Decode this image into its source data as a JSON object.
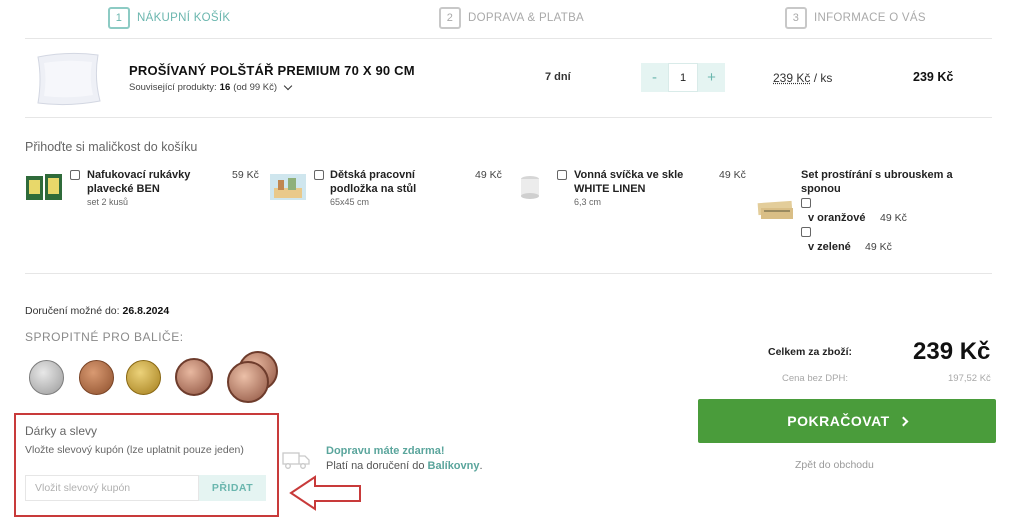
{
  "steps": [
    {
      "num": "1",
      "label": "NÁKUPNÍ KOŠÍK"
    },
    {
      "num": "2",
      "label": "DOPRAVA & PLATBA"
    },
    {
      "num": "3",
      "label": "INFORMACE O VÁS"
    }
  ],
  "cart_item": {
    "name": "PROŠÍVANÝ POLŠTÁŘ PREMIUM 70 X 90 CM",
    "related_label": "Související produkty:",
    "related_count": "16",
    "related_from": "(od 99 Kč)",
    "availability": "7 dní",
    "qty_minus": "-",
    "qty_value": "1",
    "qty_plus": "+",
    "unit_price": "239 Kč",
    "unit_suffix": " / ks",
    "line_total": "239 Kč"
  },
  "addons": {
    "heading": "Přihoďte si maličkost do košíku",
    "items": [
      {
        "name_1": "Nafukovací rukávky",
        "name_2": "plavecké BEN",
        "sub": "set 2 kusů",
        "price": "59 Kč"
      },
      {
        "name_1": "Dětská pracovní",
        "name_2": "podložka na stůl",
        "sub": "65x45 cm",
        "price": "49 Kč"
      },
      {
        "name_1": "Vonná svíčka ve skle",
        "name_2": "WHITE LINEN",
        "sub": "6,3 cm",
        "price": "49 Kč"
      },
      {
        "name_1": "Set prostírání s ubrouskem a",
        "name_2": "sponou",
        "variants": [
          {
            "label": "v oranžové",
            "price": "49 Kč"
          },
          {
            "label": "v zelené",
            "price": "49 Kč"
          }
        ]
      }
    ]
  },
  "delivery": {
    "label": "Doručení možné do:",
    "date": "26.8.2024"
  },
  "tip": {
    "heading": "SPROPITNÉ PRO BALIČE:"
  },
  "gifts": {
    "heading": "Dárky a slevy",
    "text": "Vložte slevový kupón (lze uplatnit pouze jeden)",
    "placeholder": "Vložit slevový kupón",
    "button": "PŘIDAT"
  },
  "free_shipping": {
    "line1": "Dopravu máte zdarma!",
    "line2_pre": "Platí na doručení do ",
    "line2_link": "Balíkovny",
    "line2_post": "."
  },
  "summary": {
    "total_label": "Celkem za zboží:",
    "total_value": "239 Kč",
    "net_label": "Cena bez DPH:",
    "net_value": "197,52 Kč",
    "continue": "POKRAČOVAT",
    "back": "Zpět do obchodu"
  },
  "colors": {
    "accent": "#6ab6ae",
    "primary_button": "#4a9c3b",
    "highlight_border": "#c83a3a"
  }
}
